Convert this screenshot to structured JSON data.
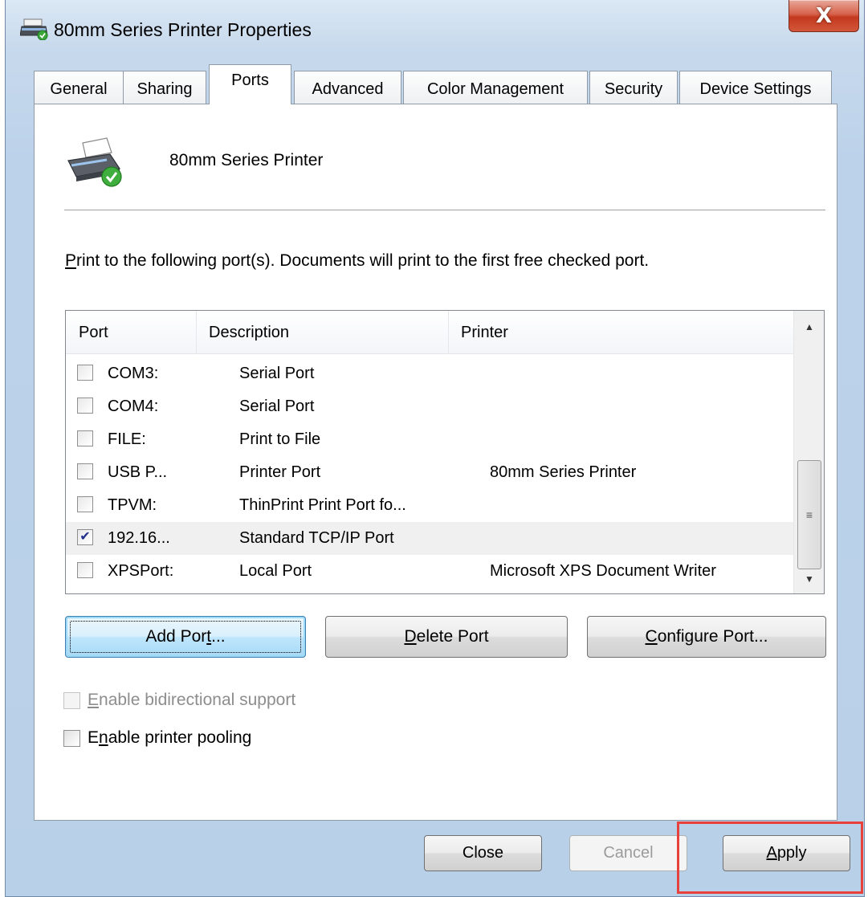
{
  "window": {
    "title": "80mm Series Printer Properties",
    "close_glyph": "X"
  },
  "tabs": [
    {
      "label": "General"
    },
    {
      "label": "Sharing"
    },
    {
      "label": "Ports"
    },
    {
      "label": "Advanced"
    },
    {
      "label": "Color Management"
    },
    {
      "label": "Security"
    },
    {
      "label": "Device Settings"
    }
  ],
  "active_tab": "Ports",
  "ports_tab": {
    "printer_name": "80mm Series Printer",
    "instructions_accel": "P",
    "instructions_rest": "rint to the following port(s). Documents will print to the first free checked port.",
    "columns": {
      "port": "Port",
      "description": "Description",
      "printer": "Printer"
    },
    "rows": [
      {
        "port": "COM3:",
        "description": "Serial Port",
        "printer": "",
        "checked": false
      },
      {
        "port": "COM4:",
        "description": "Serial Port",
        "printer": "",
        "checked": false
      },
      {
        "port": "FILE:",
        "description": "Print to File",
        "printer": "",
        "checked": false
      },
      {
        "port": "USB P...",
        "description": "Printer Port",
        "printer": "80mm Series Printer",
        "checked": false
      },
      {
        "port": "TPVM:",
        "description": "ThinPrint Print Port fo...",
        "printer": "",
        "checked": false
      },
      {
        "port": "192.16...",
        "description": "Standard TCP/IP Port",
        "printer": "",
        "checked": true
      },
      {
        "port": "XPSPort:",
        "description": "Local Port",
        "printer": "Microsoft XPS Document Writer",
        "checked": false
      }
    ],
    "add_port": {
      "before": "Add Por",
      "accel": "t",
      "after": "..."
    },
    "delete_port": {
      "before": "",
      "accel": "D",
      "after": "elete Port"
    },
    "configure_port": {
      "before": "",
      "accel": "C",
      "after": "onfigure Port..."
    },
    "bidirectional": {
      "before": "",
      "accel": "E",
      "after": "nable bidirectional support",
      "checked": false,
      "enabled": false
    },
    "pooling": {
      "before": "E",
      "accel": "n",
      "after": "able printer pooling",
      "checked": false,
      "enabled": true
    }
  },
  "footer": {
    "close_label": "Close",
    "cancel_label": "Cancel",
    "apply_accel": "A",
    "apply_rest": "pply"
  },
  "colors": {
    "highlight": "#e8413c",
    "check_mark": "#21308c"
  }
}
